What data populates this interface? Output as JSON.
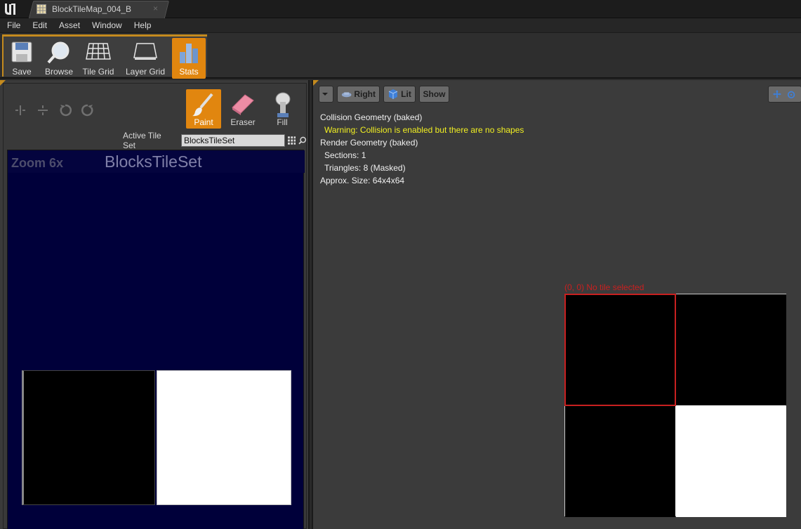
{
  "tab": {
    "title": "BlockTileMap_004_B",
    "close": "×"
  },
  "menu": [
    "File",
    "Edit",
    "Asset",
    "Window",
    "Help"
  ],
  "toolbar": {
    "save": "Save",
    "browse": "Browse",
    "tile_grid": "Tile Grid",
    "layer_grid": "Layer Grid",
    "stats": "Stats"
  },
  "paint_tools": {
    "paint": "Paint",
    "eraser": "Eraser",
    "fill": "Fill"
  },
  "active_tile_set": {
    "label": "Active Tile Set",
    "value": "BlocksTileSet"
  },
  "tile_view": {
    "zoom": "Zoom 6x",
    "title": "BlocksTileSet"
  },
  "viewport": {
    "view_button": "Right",
    "lit_button": "Lit",
    "show_button": "Show",
    "stats": {
      "collision": "Collision Geometry (baked)",
      "warning": "Warning: Collision is enabled but there are no shapes",
      "render": "Render Geometry (baked)",
      "sections": "Sections: 1",
      "triangles": "Triangles: 8 (Masked)",
      "size": "Approx. Size: 64x4x64"
    },
    "tile_status": "(0, 0) No tile selected"
  },
  "colors": {
    "accent": "#e1860f",
    "warning": "#f2f022",
    "selection": "#c82020"
  }
}
